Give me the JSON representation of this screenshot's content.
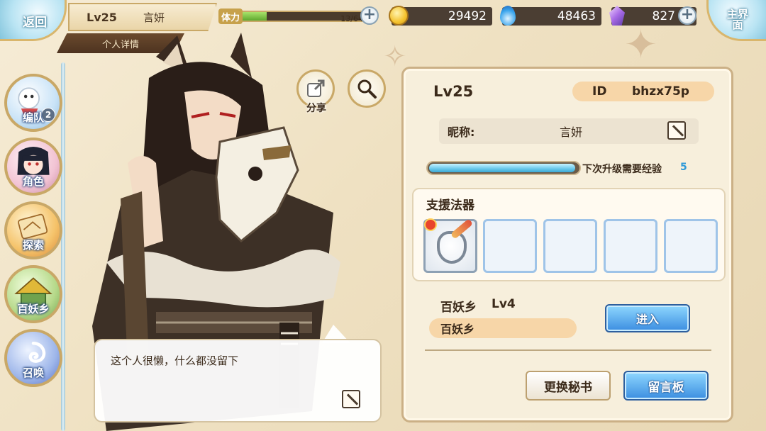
{
  "topbar": {
    "back_label": "返回",
    "home_label": "主界面",
    "level": "Lv25",
    "player_name": "言妍",
    "detail_tab": "个人详情",
    "stamina": {
      "label": "体力",
      "current": 13,
      "max": 64,
      "text": "13/64"
    },
    "resources": [
      {
        "icon": "gold-coin-icon",
        "value": "29492"
      },
      {
        "icon": "blue-flame-icon",
        "value": "48463"
      },
      {
        "icon": "crystal-icon",
        "value": "827"
      }
    ]
  },
  "nav": {
    "items": [
      {
        "label": "编队",
        "badge": "2"
      },
      {
        "label": "角色"
      },
      {
        "label": "探索"
      },
      {
        "label": "百妖乡"
      },
      {
        "label": "召唤"
      }
    ]
  },
  "actions": {
    "share_label": "分享"
  },
  "bio": {
    "text": "这个人很懒，什么都没留下"
  },
  "profile": {
    "level": "Lv25",
    "id_label": "ID",
    "id_value": "bhzx75p",
    "nickname_label": "昵称:",
    "nickname_value": "言妍",
    "exp_label": "下次升级需要经验",
    "exp_value": "5",
    "exp_progress": 0.98,
    "support_title": "支援法器",
    "village_name": "百妖乡",
    "village_level": "Lv4",
    "village_tag": "百妖乡",
    "enter_label": "进入",
    "change_secretary_label": "更换秘书",
    "message_board_label": "留言板"
  },
  "colors": {
    "accent_blue": "#3b8de0",
    "gold_border": "#c9a867",
    "panel_bg": "#f7efdc"
  }
}
